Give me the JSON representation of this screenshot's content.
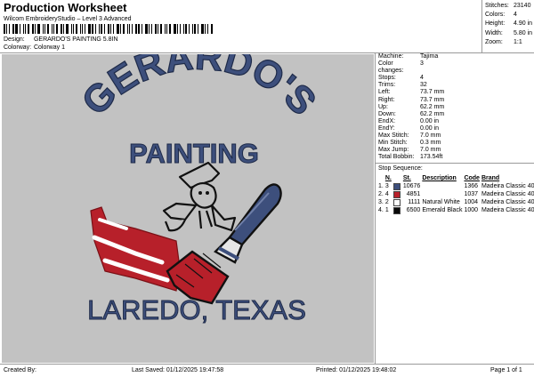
{
  "header": {
    "title": "Production Worksheet",
    "subtitle": "Wilcom EmbroideryStudio – Level 3 Advanced",
    "design_label": "Design:",
    "design_value": "GERARDO'S PAINTING 5.8IN",
    "colorway_label": "Colorway:",
    "colorway_value": "Colorway 1"
  },
  "stats": [
    {
      "label": "Stitches:",
      "value": "23140"
    },
    {
      "label": "Colors:",
      "value": "4"
    },
    {
      "label": "Height:",
      "value": "4.90 in"
    },
    {
      "label": "Width:",
      "value": "5.80 in"
    },
    {
      "label": "Zoom:",
      "value": "1:1"
    }
  ],
  "machine_info": [
    {
      "label": "Machine:",
      "value": "Tajima"
    },
    {
      "label": "Color changes:",
      "value": "3"
    },
    {
      "label": "Stops:",
      "value": "4"
    },
    {
      "label": "Trims:",
      "value": "32"
    },
    {
      "label": "Left:",
      "value": "73.7 mm"
    },
    {
      "label": "Right:",
      "value": "73.7 mm"
    },
    {
      "label": "Up:",
      "value": "62.2 mm"
    },
    {
      "label": "Down:",
      "value": "62.2 mm"
    },
    {
      "label": "EndX:",
      "value": "0.00 in"
    },
    {
      "label": "EndY:",
      "value": "0.00 in"
    },
    {
      "label": "Max Stitch:",
      "value": "7.0 mm"
    },
    {
      "label": "Min Stitch:",
      "value": "0.3 mm"
    },
    {
      "label": "Max Jump:",
      "value": "7.0 mm"
    },
    {
      "label": "Total Bobbin:",
      "value": "173.54ft"
    }
  ],
  "stop_sequence": {
    "title": "Stop Sequence:",
    "headers": {
      "n": "N.",
      "st": "St.",
      "description": "Description",
      "code": "Code",
      "brand": "Brand"
    },
    "rows": [
      {
        "index": "1.",
        "n": "3",
        "color": "#3d4f7c",
        "st": "10676",
        "description": "",
        "code": "1366",
        "brand": "Madeira Classic 40"
      },
      {
        "index": "2.",
        "n": "4",
        "color": "#b7202a",
        "st": "4851",
        "description": "",
        "code": "1037",
        "brand": "Madeira Classic 40"
      },
      {
        "index": "3.",
        "n": "2",
        "color": "#ffffff",
        "st": "1111",
        "description": "Natural White",
        "code": "1004",
        "brand": "Madeira Classic 40"
      },
      {
        "index": "4.",
        "n": "1",
        "color": "#0a0a0a",
        "st": "6500",
        "description": "Emerald Black",
        "code": "1000",
        "brand": "Madeira Classic 40"
      }
    ]
  },
  "design_art": {
    "arc_text": "GERARDO'S",
    "sub_text": "PAINTING",
    "bottom_text": "LAREDO, TEXAS",
    "background_color": "#c2c2c2",
    "blue": "#3d4f7c",
    "red": "#b7202a"
  },
  "footer": {
    "created_by": "Created By:",
    "last_saved": "Last Saved: 01/12/2025 19:47:58",
    "printed": "Printed: 01/12/2025 19:48:02",
    "page": "Page 1 of 1"
  }
}
